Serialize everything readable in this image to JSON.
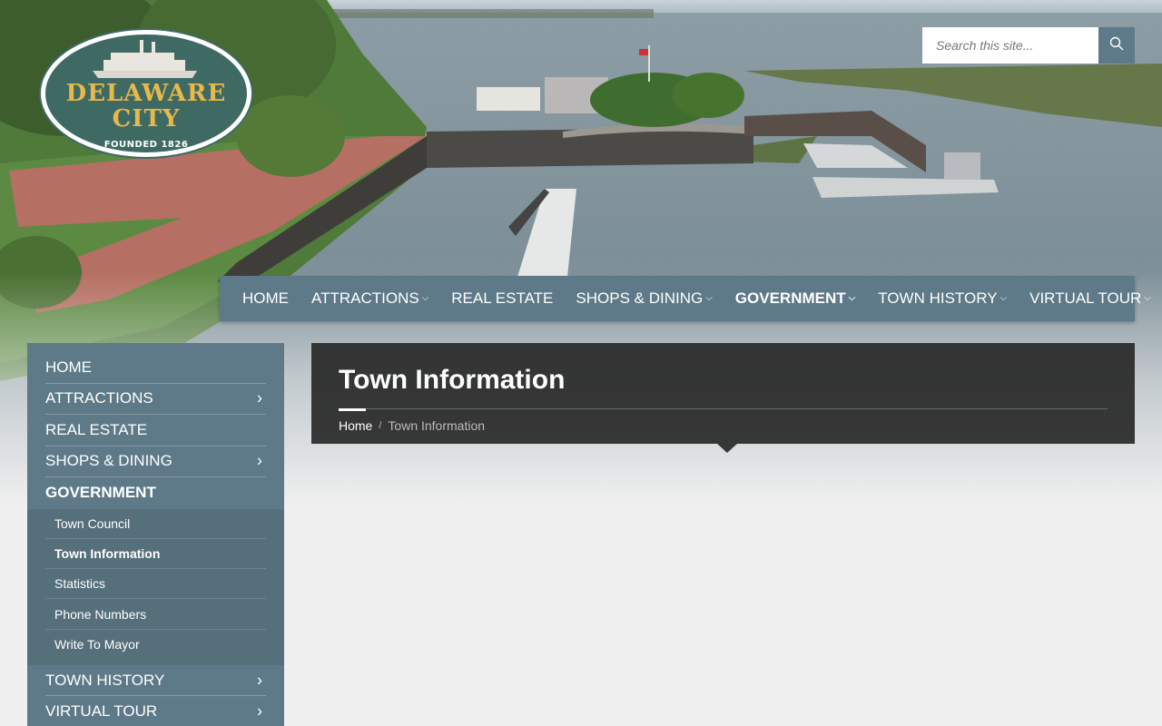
{
  "logo": {
    "line1": "DELAWARE",
    "line2": "CITY",
    "founded": "FOUNDED 1826"
  },
  "search": {
    "placeholder": "Search this site..."
  },
  "topnav": {
    "items": [
      {
        "label": "HOME",
        "dropdown": false,
        "active": false
      },
      {
        "label": "ATTRACTIONS",
        "dropdown": true,
        "active": false
      },
      {
        "label": "REAL ESTATE",
        "dropdown": false,
        "active": false
      },
      {
        "label": "SHOPS & DINING",
        "dropdown": true,
        "active": false
      },
      {
        "label": "GOVERNMENT",
        "dropdown": true,
        "active": true
      },
      {
        "label": "TOWN HISTORY",
        "dropdown": true,
        "active": false
      },
      {
        "label": "VIRTUAL TOUR",
        "dropdown": true,
        "active": false
      }
    ]
  },
  "sidebar": {
    "items": [
      {
        "label": "HOME"
      },
      {
        "label": "ATTRACTIONS"
      },
      {
        "label": "REAL ESTATE"
      },
      {
        "label": "SHOPS & DINING"
      },
      {
        "label": "GOVERNMENT"
      }
    ],
    "subitems": [
      {
        "label": "Town Council"
      },
      {
        "label": "Town Information"
      },
      {
        "label": "Statistics"
      },
      {
        "label": "Phone Numbers"
      },
      {
        "label": "Write To Mayor"
      }
    ],
    "after": [
      {
        "label": "TOWN HISTORY"
      },
      {
        "label": "VIRTUAL TOUR"
      }
    ]
  },
  "page": {
    "title": "Town Information",
    "breadcrumb": {
      "home": "Home",
      "separator": "/",
      "current": "Town Information"
    }
  },
  "colors": {
    "accent": "#5e7a88",
    "banner": "#282828",
    "logo_green": "#3f6a63",
    "logo_gold": "#e8b84a"
  }
}
